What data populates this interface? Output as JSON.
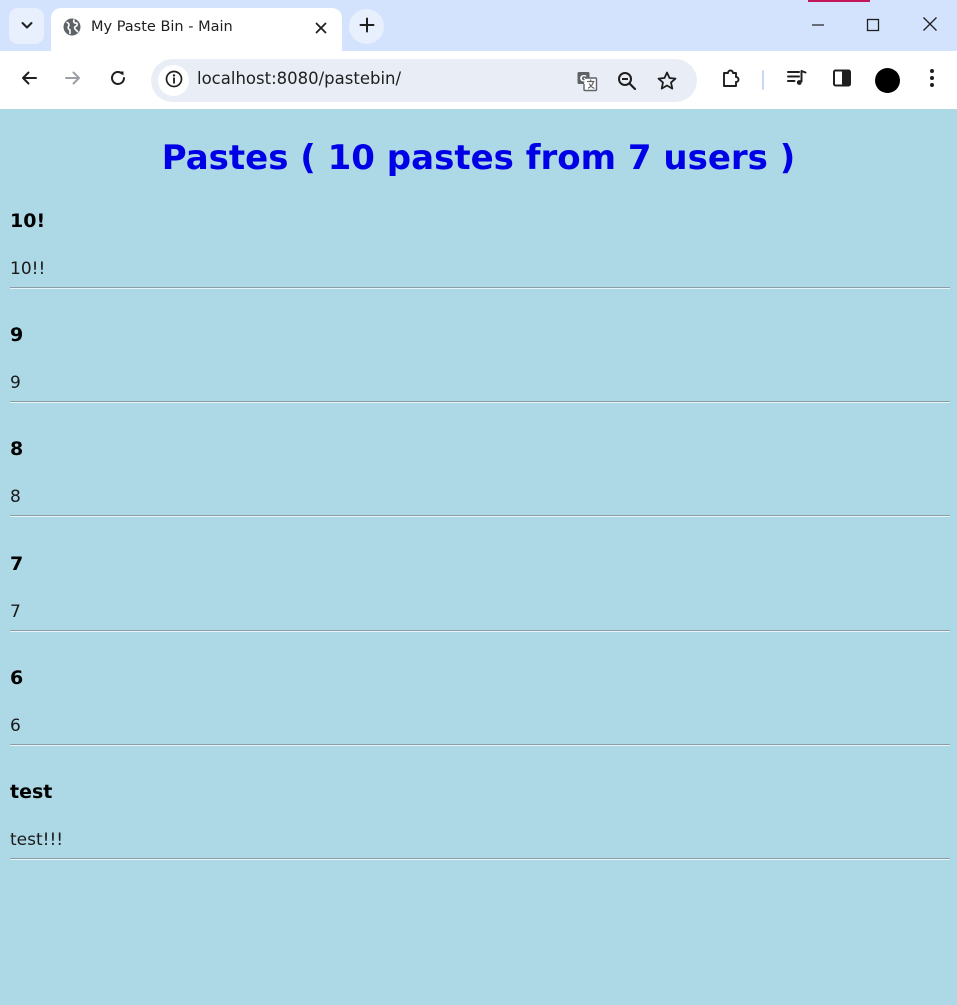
{
  "browser": {
    "tab_title": "My Paste Bin - Main",
    "url": "localhost:8080/pastebin/"
  },
  "page": {
    "title": "Pastes ( 10 pastes from 7 users )",
    "pastes": [
      {
        "title": "10!",
        "body": "10!!"
      },
      {
        "title": "9",
        "body": "9"
      },
      {
        "title": "8",
        "body": "8"
      },
      {
        "title": "7",
        "body": "7"
      },
      {
        "title": "6",
        "body": "6"
      },
      {
        "title": "test",
        "body": "test!!!"
      }
    ]
  },
  "colors": {
    "page_background": "#add8e6",
    "title_color": "#0000e6",
    "chrome_titlebar": "#d3e3fd"
  }
}
